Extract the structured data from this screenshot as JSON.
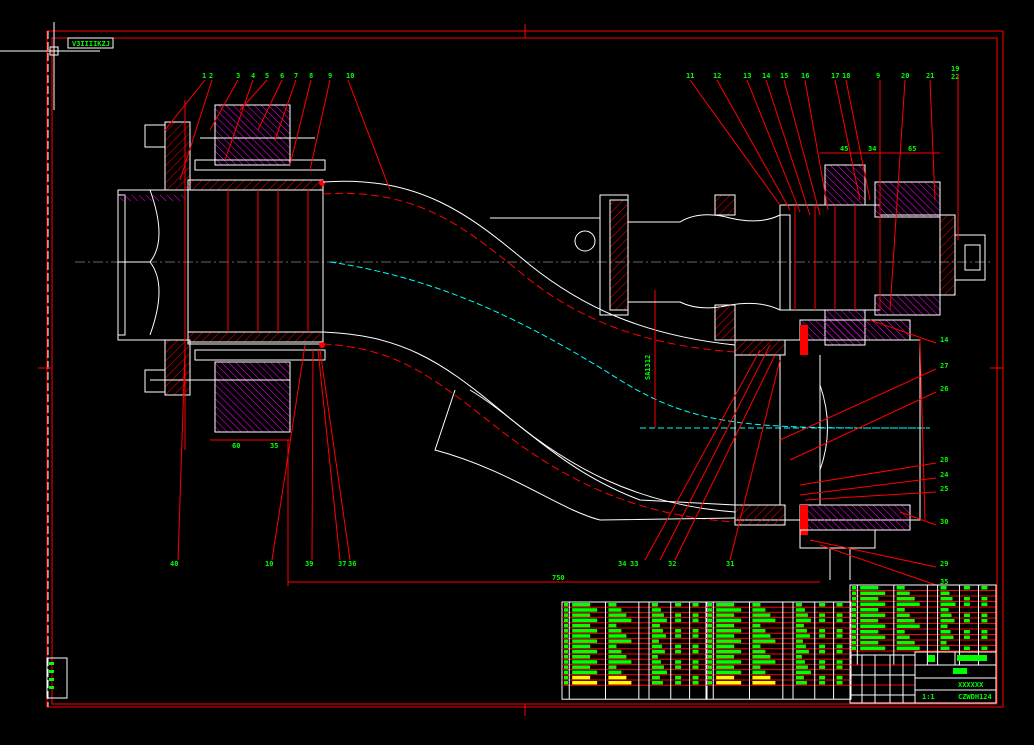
{
  "drawing": {
    "view_label": "V3IIIIKZJ",
    "colors": {
      "background": "#000000",
      "frame": "#ff0000",
      "outline": "#ffffff",
      "text": "#00ff00",
      "centerline": "#00ffff",
      "hatch": "#ff00ff",
      "highlight": "#ffff00"
    },
    "balloons_top_left": [
      "1",
      "2",
      "3",
      "4",
      "5",
      "6",
      "7",
      "8",
      "9",
      "10"
    ],
    "balloons_top_right": [
      "11",
      "12",
      "13",
      "14",
      "15",
      "16",
      "17",
      "18",
      "9",
      "20",
      "21",
      "19",
      "22"
    ],
    "balloons_right": [
      "14",
      "27",
      "26",
      "28",
      "24",
      "25",
      "30",
      "29",
      "35"
    ],
    "balloons_bottom": [
      "40",
      "10",
      "39",
      "37",
      "36",
      "34",
      "33",
      "32",
      "31"
    ],
    "dimensions": {
      "top_right": [
        "45",
        "34",
        "65"
      ],
      "left_bottom": [
        "60",
        "35"
      ],
      "overall_length": "750",
      "vertical_offset": "SA1312"
    }
  },
  "title_block": {
    "drawing_number": "XXXXXX",
    "code": "CZWDH124",
    "scale_mark": "1:1"
  }
}
